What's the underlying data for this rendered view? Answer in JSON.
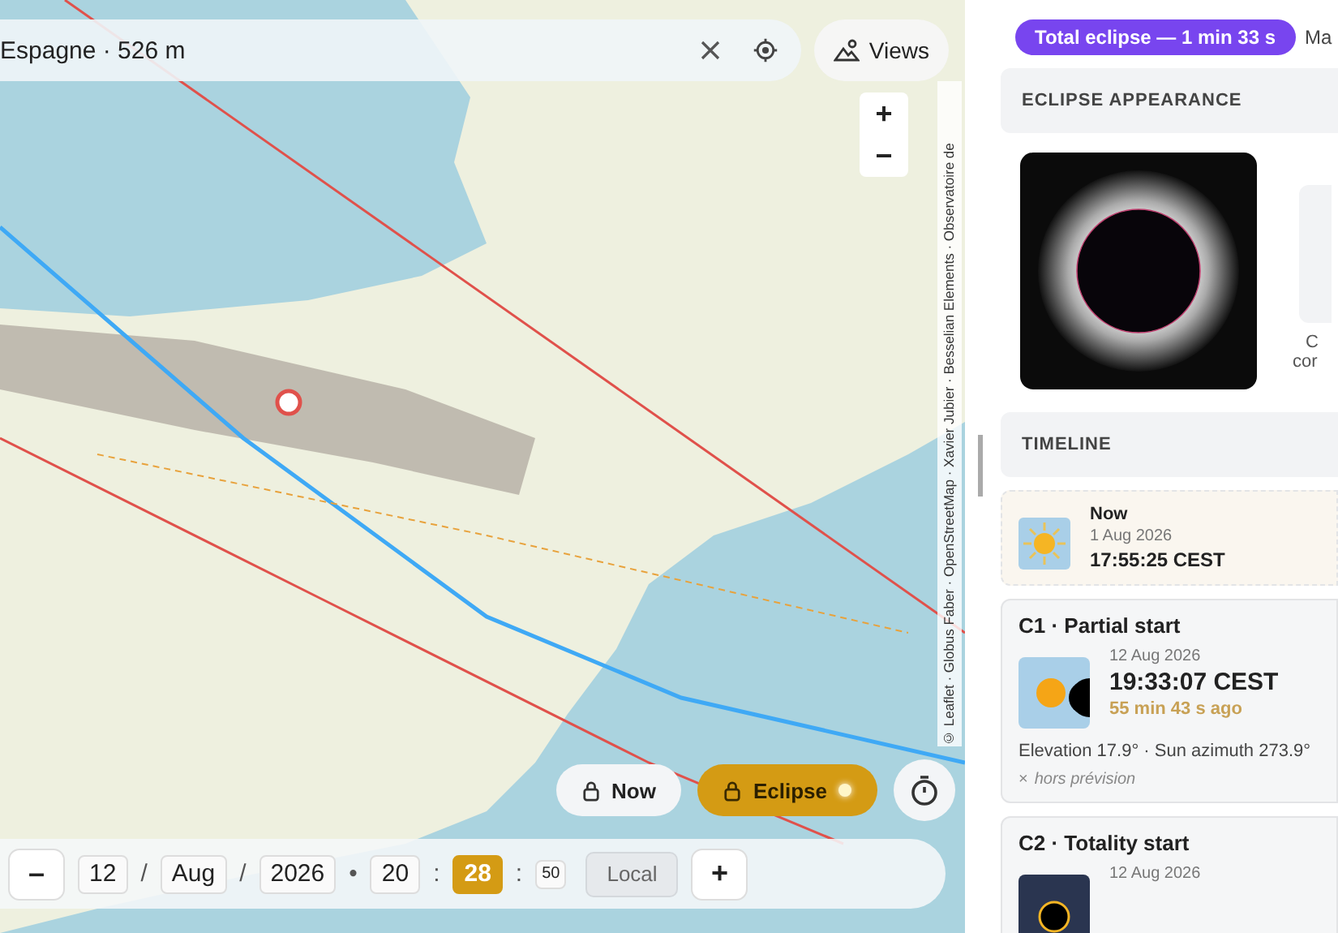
{
  "map": {
    "search": {
      "value": "Espagne · 526 m"
    },
    "views_button": {
      "label": "Views"
    },
    "zoom": {
      "in": "+",
      "out": "−"
    },
    "attribution": "© Leaflet · Globus Faber · OpenStreetMap · Xavier Jubier · Besselian Elements · Observatoire de",
    "mode_buttons": [
      {
        "label": "Now",
        "selected": false
      },
      {
        "label": "Eclipse",
        "selected": true
      }
    ],
    "date_time": {
      "minus": "–",
      "plus": "+",
      "zone": "Local",
      "items": [
        {
          "kind": "field",
          "value": "12",
          "selected": false
        },
        {
          "kind": "sep",
          "value": "/"
        },
        {
          "kind": "field",
          "value": "Aug",
          "selected": false
        },
        {
          "kind": "sep",
          "value": "/"
        },
        {
          "kind": "field",
          "value": "2026",
          "selected": false
        },
        {
          "kind": "sep",
          "value": "•"
        },
        {
          "kind": "field",
          "value": "20",
          "selected": false
        },
        {
          "kind": "sep",
          "value": ":"
        },
        {
          "kind": "field",
          "value": "28",
          "selected": true
        },
        {
          "kind": "sep",
          "value": ":"
        },
        {
          "kind": "small",
          "value": "50",
          "selected": false
        }
      ]
    }
  },
  "panel": {
    "badge": "Total eclipse — 1 min 33 s",
    "tab_cut": "Ma",
    "appearance": {
      "title": "ECLIPSE APPEARANCE",
      "side_label": [
        "C",
        "cor"
      ]
    },
    "timeline": {
      "title": "TIMELINE",
      "events": [
        {
          "kind": "now",
          "title": "Now",
          "date": "1 Aug 2026",
          "time": "17:55:25 CEST"
        },
        {
          "kind": "partial_start",
          "title": "C1 · Partial start",
          "date": "12 Aug 2026",
          "time": "19:33:07 CEST",
          "relative": "55 min 43 s ago",
          "details": "Elevation 17.9° · Sun azimuth 273.9°",
          "note_mark": "×",
          "note": "hors prévision"
        },
        {
          "kind": "totality_start",
          "title": "C2 · Totality start",
          "date": "12 Aug 2026"
        }
      ]
    }
  }
}
